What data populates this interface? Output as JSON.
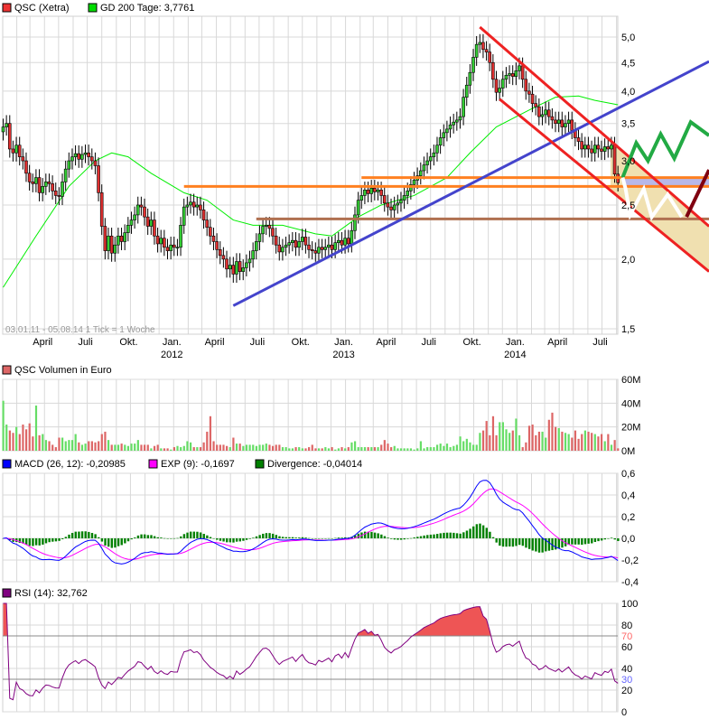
{
  "colors": {
    "candle_up": "#33cc33",
    "candle_down": "#e03030",
    "gd200": "#00ee00",
    "volume_up": "#66dd66",
    "volume_down": "#dd6666",
    "macd": "#0000ff",
    "exp": "#ff00ff",
    "divergence": "#008000",
    "rsi": "#800080",
    "rsi_upper": "#ff6666",
    "rsi_lower": "#6666ff"
  },
  "legend": {
    "price": {
      "label": "QSC (Xetra)",
      "color": "#ee3333"
    },
    "gd200": {
      "label": "GD 200 Tage: 3,7761",
      "color": "#00dd00"
    },
    "volume": {
      "label": "QSC Volumen in Euro",
      "color": "#dd6666"
    },
    "macd": {
      "label": "MACD (26, 12): -0,20985",
      "color": "#0000ff"
    },
    "exp": {
      "label": "EXP (9): -0,1697",
      "color": "#ff00ff"
    },
    "divergence": {
      "label": "Divergence: -0,04014",
      "color": "#008000"
    },
    "rsi": {
      "label": "RSI (14): 32,762",
      "color": "#800080"
    }
  },
  "range_text": "03.01.11 - 05.08.14   1 Tick = 1 Woche",
  "chart_data": [
    {
      "type": "candlestick",
      "title": "QSC (Xetra)",
      "scale": "log",
      "ylim": [
        1.5,
        5.3
      ],
      "y_ticks": [
        "1,5",
        "2,0",
        "2,5",
        "3,0",
        "3,5",
        "4,0",
        "4,5",
        "5,0"
      ],
      "y_tick_values": [
        1.5,
        2.0,
        2.5,
        3.0,
        3.5,
        4.0,
        4.5,
        5.0
      ],
      "grid": true,
      "x_start": "2011-01-03",
      "x_end": "2014-08-04",
      "x_ticks": [
        {
          "label": "April",
          "date": "2011-04-01"
        },
        {
          "label": "Juli",
          "date": "2011-07-01"
        },
        {
          "label": "Okt.",
          "date": "2011-10-01"
        },
        {
          "label": "Jan.",
          "date": "2012-01-01",
          "year": "2012"
        },
        {
          "label": "April",
          "date": "2012-04-01"
        },
        {
          "label": "Juli",
          "date": "2012-07-01"
        },
        {
          "label": "Okt.",
          "date": "2012-10-01"
        },
        {
          "label": "Jan.",
          "date": "2013-01-01",
          "year": "2013"
        },
        {
          "label": "April",
          "date": "2013-04-01"
        },
        {
          "label": "Juli",
          "date": "2013-07-01"
        },
        {
          "label": "Okt.",
          "date": "2013-10-01"
        },
        {
          "label": "Jan.",
          "date": "2014-01-01",
          "year": "2014"
        },
        {
          "label": "April",
          "date": "2014-04-01"
        },
        {
          "label": "Juli",
          "date": "2014-07-01"
        }
      ],
      "weekly_close": [
        3.45,
        3.5,
        3.15,
        3.1,
        3.2,
        3.05,
        3.0,
        2.85,
        2.75,
        2.73,
        2.8,
        2.63,
        2.7,
        2.75,
        2.73,
        2.65,
        2.6,
        2.59,
        2.75,
        2.9,
        3.0,
        3.05,
        3.09,
        3.02,
        3.08,
        3.1,
        3.05,
        3.0,
        2.94,
        2.63,
        2.29,
        2.07,
        2.2,
        2.05,
        2.12,
        2.2,
        2.15,
        2.23,
        2.3,
        2.35,
        2.4,
        2.5,
        2.48,
        2.38,
        2.29,
        2.35,
        2.2,
        2.13,
        2.18,
        2.1,
        2.07,
        2.12,
        2.1,
        2.1,
        2.3,
        2.48,
        2.5,
        2.53,
        2.48,
        2.5,
        2.45,
        2.35,
        2.28,
        2.2,
        2.15,
        2.08,
        2.03,
        2.0,
        1.92,
        1.95,
        1.88,
        1.98,
        1.9,
        1.93,
        1.97,
        2.0,
        2.07,
        2.15,
        2.22,
        2.29,
        2.3,
        2.27,
        2.2,
        2.12,
        2.06,
        2.1,
        2.12,
        2.14,
        2.16,
        2.1,
        2.15,
        2.19,
        2.12,
        2.08,
        2.07,
        2.05,
        2.1,
        2.08,
        2.1,
        2.12,
        2.08,
        2.14,
        2.16,
        2.12,
        2.18,
        2.13,
        2.25,
        2.4,
        2.55,
        2.6,
        2.66,
        2.62,
        2.68,
        2.64,
        2.66,
        2.6,
        2.52,
        2.48,
        2.45,
        2.5,
        2.52,
        2.55,
        2.6,
        2.65,
        2.72,
        2.77,
        2.82,
        2.88,
        2.95,
        3.0,
        3.05,
        3.1,
        3.2,
        3.3,
        3.37,
        3.42,
        3.48,
        3.52,
        3.55,
        3.6,
        3.9,
        4.1,
        4.32,
        4.6,
        4.85,
        4.89,
        4.75,
        4.7,
        4.5,
        4.2,
        3.98,
        4.05,
        4.2,
        4.27,
        4.3,
        4.25,
        4.35,
        4.44,
        4.2,
        4.0,
        3.95,
        3.8,
        3.75,
        3.6,
        3.63,
        3.7,
        3.6,
        3.55,
        3.5,
        3.55,
        3.45,
        3.5,
        3.55,
        3.4,
        3.3,
        3.25,
        3.15,
        3.2,
        3.15,
        3.1,
        3.2,
        3.15,
        3.12,
        3.18,
        3.15,
        3.2,
        2.84,
        2.74
      ],
      "gd200": [
        [
          "2011-01-03",
          1.78
        ],
        [
          "2011-03-14",
          2.2
        ],
        [
          "2011-05-23",
          2.7
        ],
        [
          "2011-07-18",
          3.0
        ],
        [
          "2011-08-22",
          3.1
        ],
        [
          "2011-09-26",
          3.05
        ],
        [
          "2011-11-14",
          2.85
        ],
        [
          "2012-01-23",
          2.63
        ],
        [
          "2012-03-12",
          2.55
        ],
        [
          "2012-05-07",
          2.35
        ],
        [
          "2012-06-18",
          2.3
        ],
        [
          "2012-08-20",
          2.3
        ],
        [
          "2012-10-29",
          2.22
        ],
        [
          "2012-12-03",
          2.2
        ],
        [
          "2013-01-28",
          2.38
        ],
        [
          "2013-03-18",
          2.5
        ],
        [
          "2013-05-27",
          2.6
        ],
        [
          "2013-08-05",
          2.8
        ],
        [
          "2013-09-23",
          3.1
        ],
        [
          "2013-11-18",
          3.45
        ],
        [
          "2014-01-27",
          3.7
        ],
        [
          "2014-03-24",
          3.9
        ],
        [
          "2014-05-12",
          3.92
        ],
        [
          "2014-06-16",
          3.85
        ],
        [
          "2014-08-04",
          3.78
        ]
      ],
      "drawings": [
        {
          "name": "support-line-orange-upper",
          "color": "#ff8020",
          "points": [
            [
              "2013-02-04",
              2.8
            ],
            [
              "2015-02-14",
              2.8
            ]
          ]
        },
        {
          "name": "support-line-orange-lower",
          "color": "#ff8020",
          "points": [
            [
              "2012-01-23",
              2.7
            ],
            [
              "2015-02-14",
              2.7
            ]
          ]
        },
        {
          "name": "support-line-brown",
          "color": "#b07050",
          "points": [
            [
              "2012-06-25",
              2.36
            ],
            [
              "2015-02-14",
              2.36
            ]
          ]
        },
        {
          "name": "trendline-blue",
          "color": "#4444cc",
          "points": [
            [
              "2012-05-07",
              1.65
            ],
            [
              "2015-02-14",
              4.52
            ]
          ]
        },
        {
          "name": "channel-upper-red",
          "color": "#ee2222",
          "points": [
            [
              "2013-10-14",
              5.21
            ],
            [
              "2015-02-14",
              2.29
            ]
          ]
        },
        {
          "name": "channel-lower-red",
          "color": "#ee2222",
          "points": [
            [
              "2013-11-25",
              3.87
            ],
            [
              "2015-02-14",
              1.9
            ]
          ]
        },
        {
          "name": "scenario-green",
          "color": "#22aa44",
          "points": [
            [
              "2014-08-14",
              2.8
            ],
            [
              "2014-09-12",
              3.23
            ],
            [
              "2014-10-07",
              3.0
            ],
            [
              "2014-11-03",
              3.35
            ],
            [
              "2014-12-02",
              3.03
            ],
            [
              "2015-01-06",
              3.52
            ],
            [
              "2015-02-14",
              3.33
            ]
          ]
        },
        {
          "name": "scenario-white",
          "color": "#ffffff",
          "points": [
            [
              "2014-08-14",
              2.8
            ],
            [
              "2014-08-20",
              2.68
            ],
            [
              "2014-08-30",
              2.4
            ],
            [
              "2014-09-28",
              2.67
            ],
            [
              "2014-10-15",
              2.38
            ],
            [
              "2014-11-18",
              2.61
            ],
            [
              "2014-12-18",
              2.38
            ]
          ]
        },
        {
          "name": "scenario-darkred",
          "color": "#800010",
          "points": [
            [
              "2014-12-28",
              2.38
            ],
            [
              "2015-02-14",
              2.89
            ]
          ]
        }
      ],
      "band": {
        "color": "#b8b8e8",
        "from": "2014-08-04",
        "to": "2015-02-14",
        "low": 2.7,
        "high": 2.8
      },
      "zone": {
        "color": "#f0e0b0"
      }
    },
    {
      "type": "bar",
      "title": "QSC Volumen in Euro",
      "ylim": [
        0,
        60
      ],
      "y_ticks": [
        "0M",
        "20M",
        "40M",
        "60M"
      ],
      "y_tick_values": [
        0,
        20,
        40,
        60
      ],
      "unit": "M",
      "weekly_volume": [
        42,
        22,
        17,
        15,
        20,
        14,
        22,
        18,
        23,
        12,
        38,
        13,
        14,
        9,
        8,
        5,
        3,
        11,
        11,
        8,
        9,
        9,
        14,
        7,
        5,
        6,
        8,
        8,
        7,
        8,
        14,
        16,
        9,
        5,
        5,
        5,
        6,
        5,
        4,
        6,
        6,
        9,
        5,
        5,
        5,
        2,
        4,
        5,
        2,
        2,
        2,
        1,
        3,
        4,
        3,
        4,
        8,
        7,
        3,
        3,
        3,
        7,
        16,
        29,
        8,
        5,
        5,
        5,
        4,
        3,
        11,
        6,
        6,
        4,
        5,
        5,
        5,
        4,
        5,
        5,
        6,
        5,
        4,
        5,
        5,
        3,
        3,
        2,
        2,
        3,
        3,
        2,
        2,
        3,
        5,
        2,
        2,
        2,
        3,
        2,
        3,
        1,
        2,
        3,
        2,
        3,
        7,
        8,
        3,
        3,
        3,
        3,
        3,
        3,
        3,
        5,
        9,
        6,
        3,
        4,
        2,
        2,
        2,
        2,
        2,
        1,
        2,
        8,
        2,
        3,
        3,
        3,
        5,
        6,
        4,
        6,
        3,
        4,
        5,
        12,
        8,
        10,
        7,
        5,
        5,
        15,
        17,
        25,
        13,
        29,
        13,
        24,
        24,
        18,
        15,
        17,
        27,
        13,
        3,
        7,
        21,
        22,
        13,
        16,
        16,
        11,
        26,
        32,
        20,
        19,
        16,
        15,
        14,
        11,
        17,
        10,
        14,
        17,
        16,
        15,
        14,
        12,
        14,
        8,
        14,
        5,
        9,
        2
      ]
    },
    {
      "type": "line",
      "title": "MACD (26, 12)",
      "ylim": [
        -0.4,
        0.6
      ],
      "y_ticks": [
        "-0,4",
        "-0,2",
        "0,0",
        "0,2",
        "0,4",
        "0,6"
      ],
      "y_tick_values": [
        -0.4,
        -0.2,
        0,
        0.2,
        0.4,
        0.6
      ],
      "series": [
        {
          "name": "MACD (26, 12)"
        },
        {
          "name": "EXP (9)"
        },
        {
          "name": "Divergence"
        }
      ],
      "last_values": {
        "macd": -0.20985,
        "exp": -0.1697,
        "divergence": -0.04014
      }
    },
    {
      "type": "line",
      "title": "RSI (14)",
      "ylim": [
        0,
        100
      ],
      "y_ticks": [
        "0",
        "20",
        "40",
        "60",
        "80",
        "100"
      ],
      "y_tick_values": [
        0,
        20,
        40,
        60,
        80,
        100
      ],
      "levels": [
        {
          "label": "70",
          "value": 70
        },
        {
          "label": "30",
          "value": 30
        }
      ],
      "last_value": 32.762
    }
  ]
}
